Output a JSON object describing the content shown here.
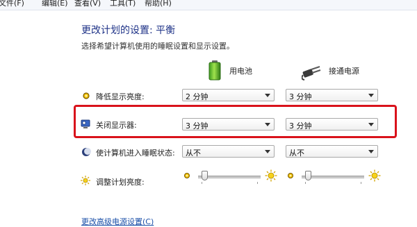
{
  "menu": [
    "文件(F)",
    "编辑(E)",
    "查看(V)",
    "工具(T)",
    "帮助(H)"
  ],
  "page": {
    "title": "更改计划的设置: 平衡",
    "subtitle": "选择希望计算机使用的睡眠设置和显示设置。"
  },
  "columns": {
    "battery": "用电池",
    "plugged": "接通电源"
  },
  "rows": {
    "dim": {
      "label": "降低显示亮度:",
      "battery": "2 分钟",
      "plugged": "3 分钟"
    },
    "off": {
      "label": "关闭显示器:",
      "battery": "3 分钟",
      "plugged": "3 分钟"
    },
    "sleep": {
      "label": "使计算机进入睡眠状态:",
      "battery": "从不",
      "plugged": "从不"
    },
    "brightness": {
      "label": "调整计划亮度:",
      "battery_level": 0.1,
      "plugged_level": 0.1
    }
  },
  "bottom_link": "更改高级电源设置(C)",
  "colors": {
    "title": "#1e3287",
    "highlight": "#d9121b",
    "link": "#1a4fa8"
  },
  "icons": {
    "battery": "battery-icon",
    "plug": "power-plug-icon",
    "dim": "dim-display-icon",
    "monitor": "monitor-icon",
    "sleep": "moon-icon",
    "brightness": "sun-icon"
  }
}
